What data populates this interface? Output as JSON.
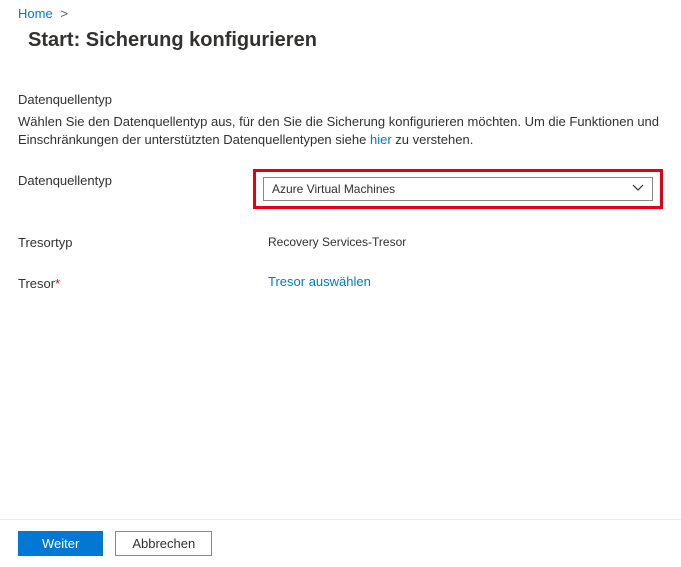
{
  "breadcrumb": {
    "home": "Home"
  },
  "page": {
    "title": "Start: Sicherung konfigurieren"
  },
  "section": {
    "heading": "Datenquellentyp",
    "description_part1": "Wählen Sie den Datenquellentyp aus, für den Sie die Sicherung konfigurieren möchten. Um die Funktionen und Einschränkungen der unterstützten Datenquellentypen siehe ",
    "description_link": "hier",
    "description_part2": " zu verstehen."
  },
  "form": {
    "datasource_type_label": "Datenquellentyp",
    "datasource_type_value": "Azure Virtual Machines",
    "vault_type_label": "Tresortyp",
    "vault_type_value": "Recovery Services-Tresor",
    "vault_label": "Tresor",
    "vault_required": "*",
    "vault_select_link": "Tresor auswählen"
  },
  "footer": {
    "next": "Weiter",
    "cancel": "Abbrechen"
  }
}
